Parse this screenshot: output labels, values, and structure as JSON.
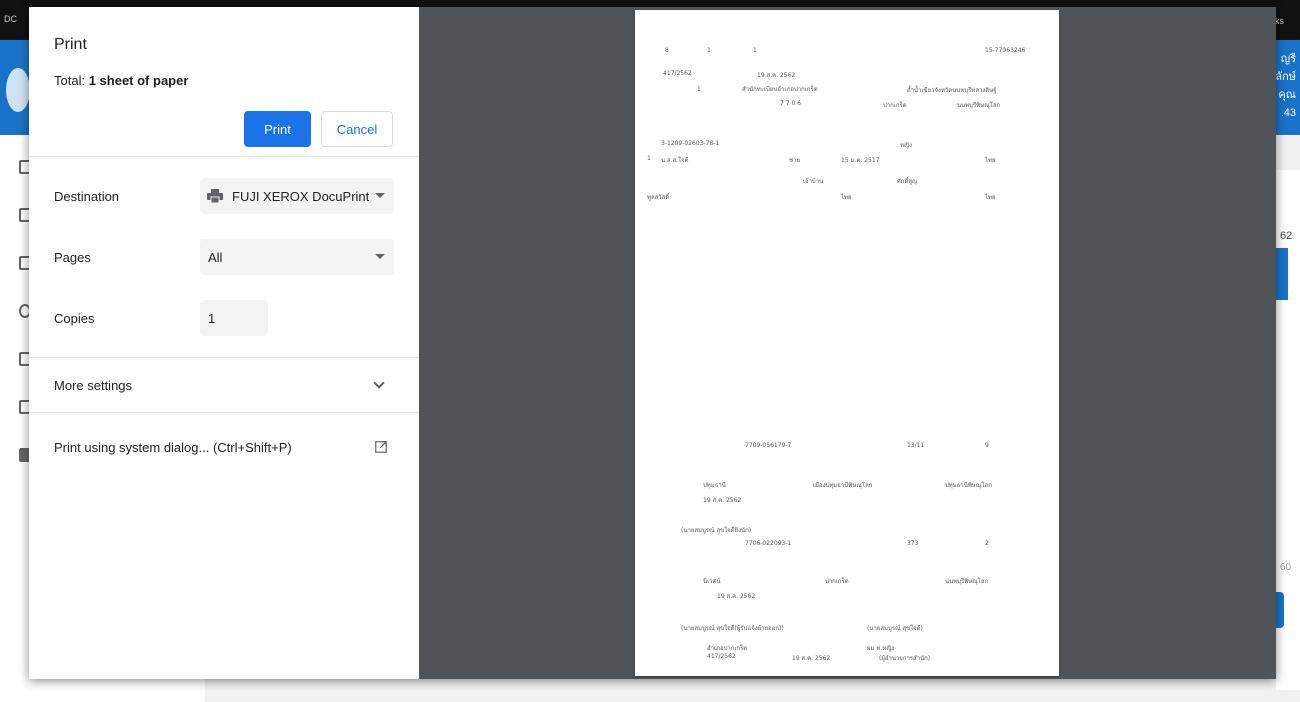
{
  "background": {
    "topbar_left": "DC",
    "topbar_right": "ks",
    "banner_lines": [
      "ญรี",
      "ลักษ์",
      "คุณ",
      ".43"
    ],
    "right_value": "62",
    "right_value2": "60"
  },
  "dialog": {
    "title": "Print",
    "total_label": "Total:",
    "total_value": "1 sheet of paper",
    "print_button": "Print",
    "cancel_button": "Cancel",
    "destination_label": "Destination",
    "destination_value": "FUJI XEROX DocuPrint",
    "pages_label": "Pages",
    "pages_value": "All",
    "copies_label": "Copies",
    "copies_value": "1",
    "more_settings": "More settings",
    "system_dialog": "Print using system dialog... (Ctrl+Shift+P)"
  },
  "preview": {
    "top_num1": "8",
    "top_num2": "1",
    "top_num3": "1",
    "doc_no": "15-77963246",
    "ref1": "417/2562",
    "date1": "19 ส.ค. 2562",
    "num1": "1",
    "office": "สำนักทะเบียนอำเภอปากเกร็ด",
    "addr": "ถ้ำน้ำเขียวจังหวัดนนทบุรีหลวงดิษฐ์",
    "code": "7 7 0 6",
    "district": "ปากเกร็ด",
    "province1": "นนทบุรีพิษณุโลก",
    "id_no": "3-1209-02603-78-1",
    "status": "หญิง",
    "row_no": "1",
    "name1": "น.ส.ส.ใจดี",
    "label_a": "ชาย",
    "birth": "15 ม.ค. 2517",
    "nat1": "ไทย",
    "house": "เจ้าบ้าน",
    "nat2": "ไทย",
    "rel": "ศักดิ์สูญ",
    "name2": "พูลสวัสดิ์",
    "nat3": "ไทย",
    "ref2": "7709-056179-7",
    "r2a": "13/11",
    "r2b": "9",
    "place1": "ปทุมธานี",
    "place2": "เมืองปทุมธานีพิษณุโลก",
    "place3": "ปทุมธานีพิษณุโลก",
    "date2": "19 ส.ค. 2562",
    "officer1": "(นายสมบูรณ์ สุขใจดียิ่งนัก)",
    "ref3": "7706-022093-1",
    "r3a": "373",
    "r3b": "2",
    "place4": "นิเวศน์",
    "place5": "ปากเกร็ด",
    "place6": "นนทบุรีพิษณุโลก",
    "date3": "19 ส.ค. 2562",
    "officer2": "(นายสมบูรณ์ สุขใจดี(ผู้รับแจ้งย้ายออก))",
    "officer3": "(นายสมบูรณ์ สุขใจดี)",
    "sig_office": "อำเภอปากเกร็ด",
    "sig_ref": "417/2562",
    "sig_date": "19 ส.ค. 2562",
    "sig_name": "ผม ท.หญิง",
    "sig_title": "(ผู้อำนวยการสำนัก)"
  }
}
